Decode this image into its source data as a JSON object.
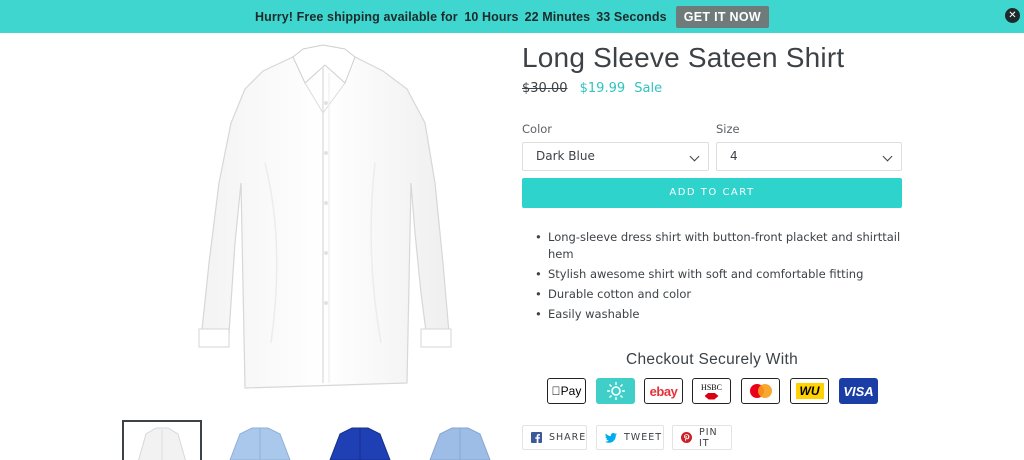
{
  "promo": {
    "prefix": "Hurry! Free shipping available for",
    "hours": "10 Hours",
    "minutes": "22 Minutes",
    "seconds": "33 Seconds",
    "cta": "GET IT NOW",
    "close_icon": "close-circle-icon"
  },
  "product": {
    "title": "Long Sleeve Sateen Shirt",
    "price_old": "$30.00",
    "price_new": "$19.99",
    "sale_label": "Sale",
    "color_label": "Color",
    "color_value": "Dark Blue",
    "size_label": "Size",
    "size_value": "4",
    "add_to_cart": "ADD TO CART",
    "features": [
      "Long-sleeve dress shirt with button-front placket and shirttail hem",
      "Stylish awesome shirt with soft and comfortable fitting",
      "Durable cotton and color",
      "Easily washable"
    ]
  },
  "thumbnails": [
    {
      "name": "white-shirt-thumb",
      "color": "#f4f4f4"
    },
    {
      "name": "light-blue-shirt-thumb",
      "color": "#a9c8ec"
    },
    {
      "name": "dark-blue-shirt-thumb",
      "color": "#1f3fb4"
    },
    {
      "name": "sky-blue-shirt-thumb",
      "color": "#9dbde6"
    }
  ],
  "checkout": {
    "title": "Checkout Securely With",
    "methods": {
      "apple_pay": "Pay",
      "ebay": "ebay",
      "hsbc": "HSBC",
      "western_union": "WU",
      "visa": "VISA"
    }
  },
  "share": {
    "facebook": "SHARE",
    "twitter": "TWEET",
    "pinterest": "PIN IT"
  },
  "colors": {
    "accent": "#2ed3cc",
    "promo_bg": "#3fd6cf",
    "text": "#3d4246"
  }
}
